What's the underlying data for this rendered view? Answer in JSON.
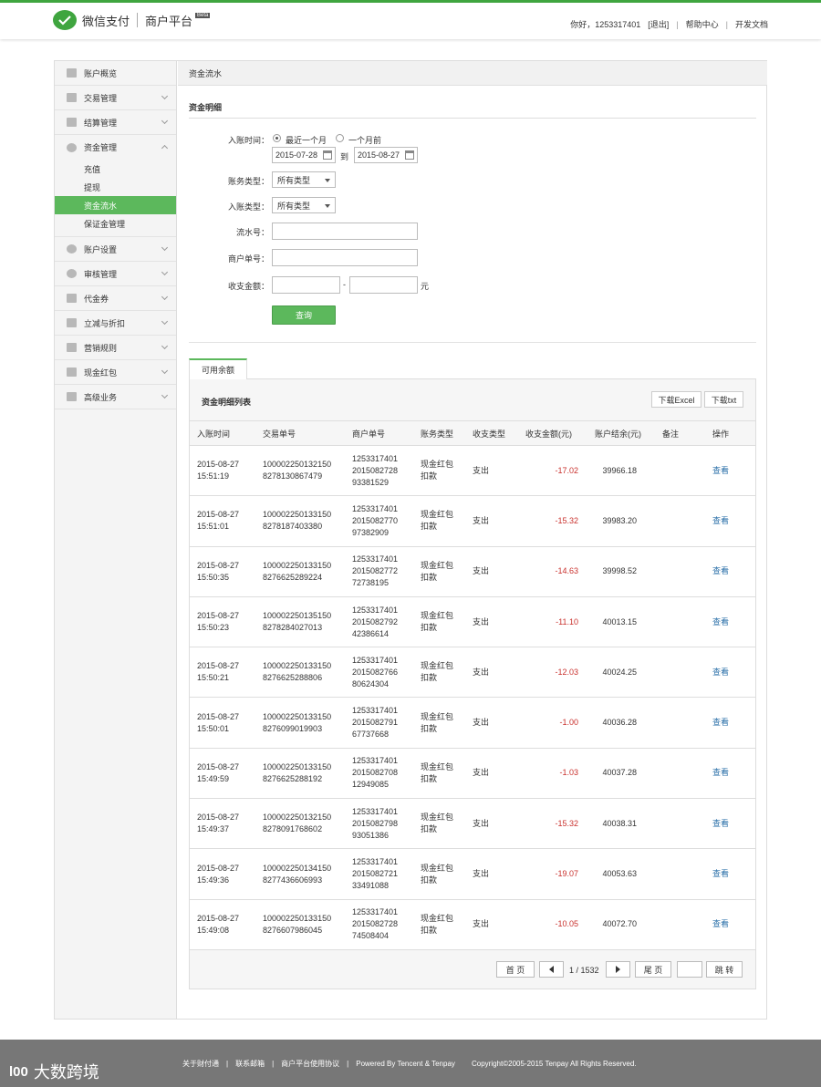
{
  "header": {
    "brand": "微信支付",
    "product": "商户平台",
    "beta": "Beta",
    "greeting": "你好，1253317401",
    "logout": "[退出]",
    "help": "帮助中心",
    "dev_docs": "开发文档"
  },
  "sidebar": {
    "items": [
      {
        "label": "账户概览"
      },
      {
        "label": "交易管理"
      },
      {
        "label": "结算管理"
      },
      {
        "label": "资金管理"
      },
      {
        "label": "账户设置"
      },
      {
        "label": "审核管理"
      },
      {
        "label": "代金券"
      },
      {
        "label": "立减与折扣"
      },
      {
        "label": "营销规则"
      },
      {
        "label": "现金红包"
      },
      {
        "label": "高级业务"
      }
    ],
    "sub_items": [
      {
        "label": "充值"
      },
      {
        "label": "提现"
      },
      {
        "label": "资金流水"
      },
      {
        "label": "保证金管理"
      }
    ]
  },
  "content": {
    "breadcrumb": "资金流水",
    "section_title": "资金明细",
    "form": {
      "entry_time_label": "入账时间：",
      "radio_recent": "最近一个月",
      "radio_older": "一个月前",
      "date_from": "2015-07-28",
      "to": "到",
      "date_to": "2015-08-27",
      "account_type_label": "账务类型：",
      "account_type_value": "所有类型",
      "entry_type_label": "入账类型：",
      "entry_type_value": "所有类型",
      "serial_label": "流水号：",
      "merchant_no_label": "商户单号：",
      "amount_label": "收支金额：",
      "amount_sep": "-",
      "amount_unit": "元",
      "query_button": "查询"
    },
    "tab": "可用余额",
    "list_title": "资金明细列表",
    "download_excel": "下载Excel",
    "download_txt": "下载txt",
    "table": {
      "headers": [
        "入账时间",
        "交易单号",
        "商户单号",
        "账务类型",
        "收支类型",
        "收支金额(元)",
        "账户结余(元)",
        "备注",
        "操作"
      ],
      "rows": [
        {
          "date": "2015-08-27",
          "time": "15:51:19",
          "tx1": "100002250132150",
          "tx2": "8278130867479",
          "m1": "1253317401",
          "m2": "2015082728",
          "m3": "93381529",
          "type1": "现金红包",
          "type2": "扣款",
          "io": "支出",
          "amount": "-17.02",
          "balance": "39966.18",
          "op": "查看"
        },
        {
          "date": "2015-08-27",
          "time": "15:51:01",
          "tx1": "100002250133150",
          "tx2": "8278187403380",
          "m1": "1253317401",
          "m2": "2015082770",
          "m3": "97382909",
          "type1": "现金红包",
          "type2": "扣款",
          "io": "支出",
          "amount": "-15.32",
          "balance": "39983.20",
          "op": "查看"
        },
        {
          "date": "2015-08-27",
          "time": "15:50:35",
          "tx1": "100002250133150",
          "tx2": "8276625289224",
          "m1": "1253317401",
          "m2": "2015082772",
          "m3": "72738195",
          "type1": "现金红包",
          "type2": "扣款",
          "io": "支出",
          "amount": "-14.63",
          "balance": "39998.52",
          "op": "查看"
        },
        {
          "date": "2015-08-27",
          "time": "15:50:23",
          "tx1": "100002250135150",
          "tx2": "8278284027013",
          "m1": "1253317401",
          "m2": "2015082792",
          "m3": "42386614",
          "type1": "现金红包",
          "type2": "扣款",
          "io": "支出",
          "amount": "-11.10",
          "balance": "40013.15",
          "op": "查看"
        },
        {
          "date": "2015-08-27",
          "time": "15:50:21",
          "tx1": "100002250133150",
          "tx2": "8276625288806",
          "m1": "1253317401",
          "m2": "2015082766",
          "m3": "80624304",
          "type1": "现金红包",
          "type2": "扣款",
          "io": "支出",
          "amount": "-12.03",
          "balance": "40024.25",
          "op": "查看"
        },
        {
          "date": "2015-08-27",
          "time": "15:50:01",
          "tx1": "100002250133150",
          "tx2": "8276099019903",
          "m1": "1253317401",
          "m2": "2015082791",
          "m3": "67737668",
          "type1": "现金红包",
          "type2": "扣款",
          "io": "支出",
          "amount": "-1.00",
          "balance": "40036.28",
          "op": "查看"
        },
        {
          "date": "2015-08-27",
          "time": "15:49:59",
          "tx1": "100002250133150",
          "tx2": "8276625288192",
          "m1": "1253317401",
          "m2": "2015082708",
          "m3": "12949085",
          "type1": "现金红包",
          "type2": "扣款",
          "io": "支出",
          "amount": "-1.03",
          "balance": "40037.28",
          "op": "查看"
        },
        {
          "date": "2015-08-27",
          "time": "15:49:37",
          "tx1": "100002250132150",
          "tx2": "8278091768602",
          "m1": "1253317401",
          "m2": "2015082798",
          "m3": "93051386",
          "type1": "现金红包",
          "type2": "扣款",
          "io": "支出",
          "amount": "-15.32",
          "balance": "40038.31",
          "op": "查看"
        },
        {
          "date": "2015-08-27",
          "time": "15:49:36",
          "tx1": "100002250134150",
          "tx2": "8277436606993",
          "m1": "1253317401",
          "m2": "2015082721",
          "m3": "33491088",
          "type1": "现金红包",
          "type2": "扣款",
          "io": "支出",
          "amount": "-19.07",
          "balance": "40053.63",
          "op": "查看"
        },
        {
          "date": "2015-08-27",
          "time": "15:49:08",
          "tx1": "100002250133150",
          "tx2": "8276607986045",
          "m1": "1253317401",
          "m2": "2015082728",
          "m3": "74508404",
          "type1": "现金红包",
          "type2": "扣款",
          "io": "支出",
          "amount": "-10.05",
          "balance": "40072.70",
          "op": "查看"
        }
      ]
    },
    "pager": {
      "first": "首 页",
      "page_info": "1 / 1532",
      "last": "尾 页",
      "jump": "跳 转"
    }
  },
  "footer": {
    "links": [
      "关于财付通",
      "联系邮箱",
      "商户平台使用协议",
      "Powered By Tencent & Tenpay",
      "Copyright©2005-2015 Tenpay All Rights Reserved."
    ],
    "seps": [
      "|",
      "|",
      "|",
      "|"
    ],
    "watermark_logo": "l00",
    "watermark_text": "大数跨境"
  },
  "colors": {
    "brand_green": "#3fa53f",
    "button_green": "#5cb85c",
    "amount_red": "#c9302c",
    "link_blue": "#2a6fa8"
  }
}
